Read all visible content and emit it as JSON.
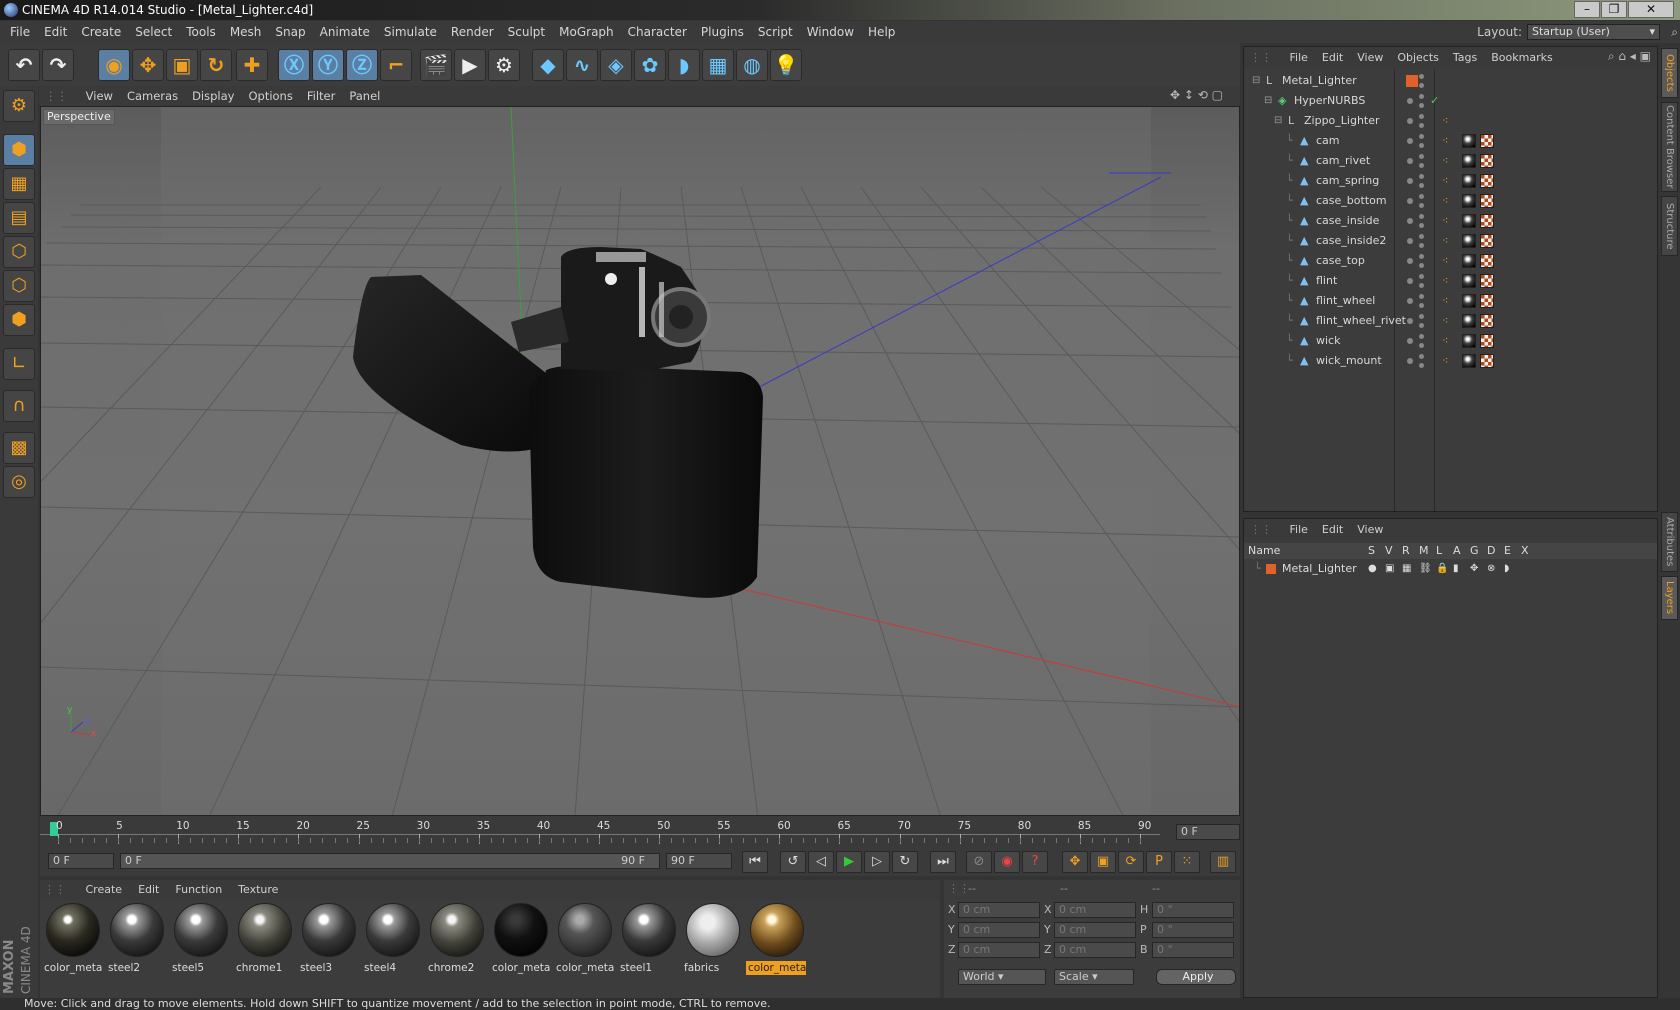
{
  "window": {
    "title": "CINEMA 4D R14.014 Studio - [Metal_Lighter.c4d]",
    "buttons": [
      "–",
      "❐",
      "✕"
    ]
  },
  "menubar": {
    "items": [
      "File",
      "Edit",
      "Create",
      "Select",
      "Tools",
      "Mesh",
      "Snap",
      "Animate",
      "Simulate",
      "Render",
      "Sculpt",
      "MoGraph",
      "Character",
      "Plugins",
      "Script",
      "Window",
      "Help"
    ],
    "layout_label": "Layout:",
    "layout_value": "Startup (User)"
  },
  "toolbar": {
    "icons": [
      "undo-icon",
      "redo-icon",
      "live-selection-icon",
      "move-icon",
      "scale-icon",
      "rotate-icon",
      "add-object-icon",
      "x-axis-icon",
      "y-axis-icon",
      "z-axis-icon",
      "coordinate-system-icon",
      "render-view-icon",
      "render-picture-viewer-icon",
      "render-settings-icon",
      "cube-icon",
      "spline-icon",
      "nurbs-icon",
      "array-icon",
      "deformer-icon",
      "floor-icon",
      "camera-icon",
      "light-icon"
    ]
  },
  "viewport": {
    "menu": [
      "View",
      "Cameras",
      "Display",
      "Options",
      "Filter",
      "Panel"
    ],
    "label": "Perspective",
    "axis": {
      "y": "y",
      "z": "z",
      "x": "x"
    }
  },
  "timeline": {
    "ticks": [
      "0",
      "5",
      "10",
      "15",
      "20",
      "25",
      "30",
      "35",
      "40",
      "45",
      "50",
      "55",
      "60",
      "65",
      "70",
      "75",
      "80",
      "85",
      "90"
    ],
    "frame_field": "0 F"
  },
  "playbar": {
    "start": "0 F",
    "range_start": "0 F",
    "range_end": "90 F",
    "end": "90 F"
  },
  "materials": {
    "menu": [
      "Create",
      "Edit",
      "Function",
      "Texture"
    ],
    "items": [
      {
        "name": "color_meta",
        "style": "dark"
      },
      {
        "name": "steel2",
        "style": "steel"
      },
      {
        "name": "steel5",
        "style": "steel"
      },
      {
        "name": "chrome1",
        "style": "chrome"
      },
      {
        "name": "steel3",
        "style": "steel"
      },
      {
        "name": "steel4",
        "style": "steel"
      },
      {
        "name": "chrome2",
        "style": "chrome"
      },
      {
        "name": "color_meta",
        "style": "black"
      },
      {
        "name": "color_meta",
        "style": "grey"
      },
      {
        "name": "steel1",
        "style": "steel"
      },
      {
        "name": "fabrics",
        "style": "fabric"
      },
      {
        "name": "color_meta",
        "style": "gold"
      }
    ],
    "active_index": 11
  },
  "maxon": {
    "line1": "MAXON",
    "line2": "CINEMA 4D"
  },
  "coords": {
    "headers": [
      "--",
      "--",
      "--"
    ],
    "rows": [
      {
        "a": "X",
        "av": "0 cm",
        "b": "X",
        "bv": "0 cm",
        "c": "H",
        "cv": "0 °"
      },
      {
        "a": "Y",
        "av": "0 cm",
        "b": "Y",
        "bv": "0 cm",
        "c": "P",
        "cv": "0 °"
      },
      {
        "a": "Z",
        "av": "0 cm",
        "b": "Z",
        "bv": "0 cm",
        "c": "B",
        "cv": "0 °"
      }
    ],
    "world": "World",
    "scale": "Scale",
    "apply": "Apply"
  },
  "objects": {
    "menu": [
      "File",
      "Edit",
      "View",
      "Objects",
      "Tags",
      "Bookmarks"
    ],
    "tree": [
      {
        "name": "Metal_Lighter",
        "level": 0,
        "type": "null"
      },
      {
        "name": "HyperNURBS",
        "level": 1,
        "type": "nurbs"
      },
      {
        "name": "Zippo_Lighter",
        "level": 2,
        "type": "null"
      },
      {
        "name": "cam",
        "level": 3,
        "type": "poly"
      },
      {
        "name": "cam_rivet",
        "level": 3,
        "type": "poly"
      },
      {
        "name": "cam_spring",
        "level": 3,
        "type": "poly"
      },
      {
        "name": "case_bottom",
        "level": 3,
        "type": "poly"
      },
      {
        "name": "case_inside",
        "level": 3,
        "type": "poly"
      },
      {
        "name": "case_inside2",
        "level": 3,
        "type": "poly"
      },
      {
        "name": "case_top",
        "level": 3,
        "type": "poly"
      },
      {
        "name": "flint",
        "level": 3,
        "type": "poly"
      },
      {
        "name": "flint_wheel",
        "level": 3,
        "type": "poly"
      },
      {
        "name": "flint_wheel_rivet",
        "level": 3,
        "type": "poly"
      },
      {
        "name": "wick",
        "level": 3,
        "type": "poly"
      },
      {
        "name": "wick_mount",
        "level": 3,
        "type": "poly"
      }
    ]
  },
  "layers": {
    "menu": [
      "File",
      "Edit",
      "View"
    ],
    "columns": [
      "Name",
      "S",
      "V",
      "R",
      "M",
      "L",
      "A",
      "G",
      "D",
      "E",
      "X"
    ],
    "rows": [
      {
        "name": "Metal_Lighter",
        "color": "#e0622a"
      }
    ]
  },
  "sidetabs": [
    "Objects",
    "Content Browser",
    "Structure",
    "Attributes",
    "Layers"
  ],
  "status": "Move: Click and drag to move elements. Hold down SHIFT to quantize movement / add to the selection in point mode, CTRL to remove.",
  "colors": {
    "accent": "#f0a020",
    "selection": "#5b7ea3",
    "layer": "#e0622a"
  }
}
